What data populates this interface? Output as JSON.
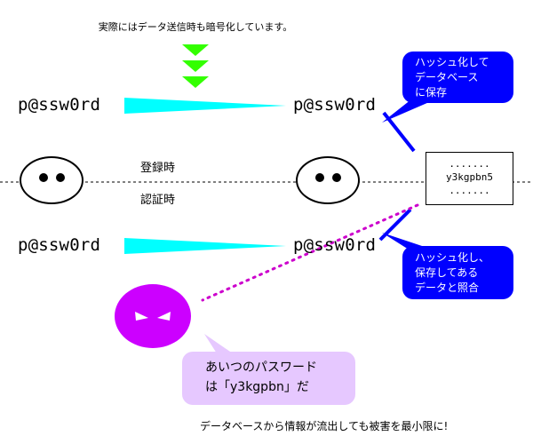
{
  "top_note": "実際にはデータ送信時も暗号化しています。",
  "password_register_client": "p@ssw0rd",
  "password_register_server": "p@ssw0rd",
  "password_login_client": "p@ssw0rd",
  "password_login_server": "p@ssw0rd",
  "label_register": "登録時",
  "label_login": "認証時",
  "db_box": {
    "line1": ".......",
    "line2": "y3kgpbn5",
    "line3": "......."
  },
  "bubble_store": {
    "line1": "ハッシュ化して",
    "line2": "データベース",
    "line3": "に保存"
  },
  "bubble_compare": {
    "line1": "ハッシュ化し、",
    "line2": "保存してある",
    "line3": "データと照合"
  },
  "attacker_bubble": {
    "line1": "あいつのパスワード",
    "line2": "は「y3kgpbn」だ"
  },
  "bottom_note": "データベースから情報が流出しても被害を最小限に!",
  "colors": {
    "arrow_green": "#33ff00",
    "beam_cyan": "#00ffff",
    "bubble_blue": "#0000ff",
    "attacker_purple": "#cc00ff",
    "attacker_bubble_fill": "#e6c8ff",
    "leak_dots": "#cc00cc"
  }
}
